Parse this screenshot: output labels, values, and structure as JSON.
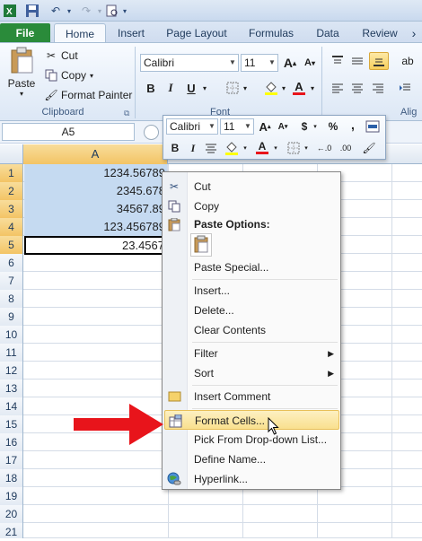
{
  "tabs": [
    "File",
    "Home",
    "Insert",
    "Page Layout",
    "Formulas",
    "Data",
    "Review"
  ],
  "clipboard": {
    "paste": "Paste",
    "cut": "Cut",
    "copy": "Copy",
    "format_painter": "Format Painter",
    "group_label": "Clipboard"
  },
  "font": {
    "name": "Calibri",
    "size": "11",
    "group_label": "Font"
  },
  "alignment": {
    "group_label": "Alig"
  },
  "name_box": "A5",
  "grid": {
    "column": "A",
    "rows": [
      "1",
      "2",
      "3",
      "4",
      "5",
      "6",
      "7",
      "8",
      "9",
      "10",
      "11",
      "12",
      "13",
      "14",
      "15",
      "16",
      "17",
      "18",
      "19",
      "20",
      "21"
    ],
    "values": [
      "1234.56789",
      "2345.678",
      "34567.89",
      "123.456789",
      "23.4567"
    ]
  },
  "mini_toolbar": {
    "font": "Calibri",
    "size": "11",
    "currency": "$",
    "percent": "%",
    "comma": ","
  },
  "context_menu": {
    "cut": "Cut",
    "copy": "Copy",
    "paste_options": "Paste Options:",
    "paste_special": "Paste Special...",
    "insert": "Insert...",
    "delete": "Delete...",
    "clear_contents": "Clear Contents",
    "filter": "Filter",
    "sort": "Sort",
    "insert_comment": "Insert Comment",
    "format_cells": "Format Cells...",
    "pick_from_list": "Pick From Drop-down List...",
    "define_name": "Define Name...",
    "hyperlink": "Hyperlink..."
  },
  "colors": {
    "file_tab": "#2a8b3a",
    "selection": "#c5daf1",
    "highlight": "#f9e08e",
    "arrow": "#e8141b"
  }
}
